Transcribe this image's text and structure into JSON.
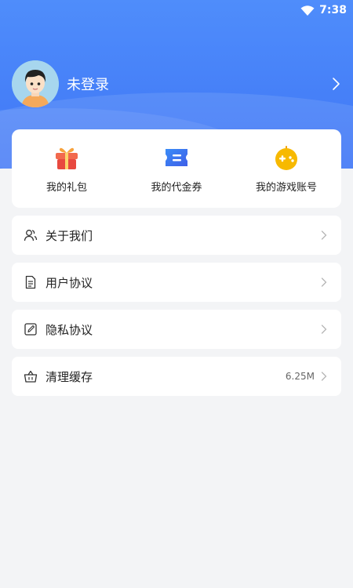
{
  "status_bar": {
    "time": "7:38"
  },
  "profile": {
    "login_text": "未登录"
  },
  "quick_actions": [
    {
      "label": "我的礼包",
      "icon": "gift-icon"
    },
    {
      "label": "我的代金券",
      "icon": "voucher-icon"
    },
    {
      "label": "我的游戏账号",
      "icon": "game-controller-icon"
    }
  ],
  "menu": [
    {
      "label": "关于我们",
      "icon": "users-icon",
      "value": ""
    },
    {
      "label": "用户协议",
      "icon": "document-icon",
      "value": ""
    },
    {
      "label": "隐私协议",
      "icon": "edit-document-icon",
      "value": ""
    },
    {
      "label": "清理缓存",
      "icon": "basket-icon",
      "value": "6.25M"
    }
  ],
  "colors": {
    "header_gradient_top": "#4f8dfb",
    "header_gradient_bottom": "#3f76f6",
    "background": "#f3f4f6",
    "gift_red": "#ef5a4f",
    "voucher_blue": "#2f7af6",
    "controller_yellow": "#f6b400"
  }
}
